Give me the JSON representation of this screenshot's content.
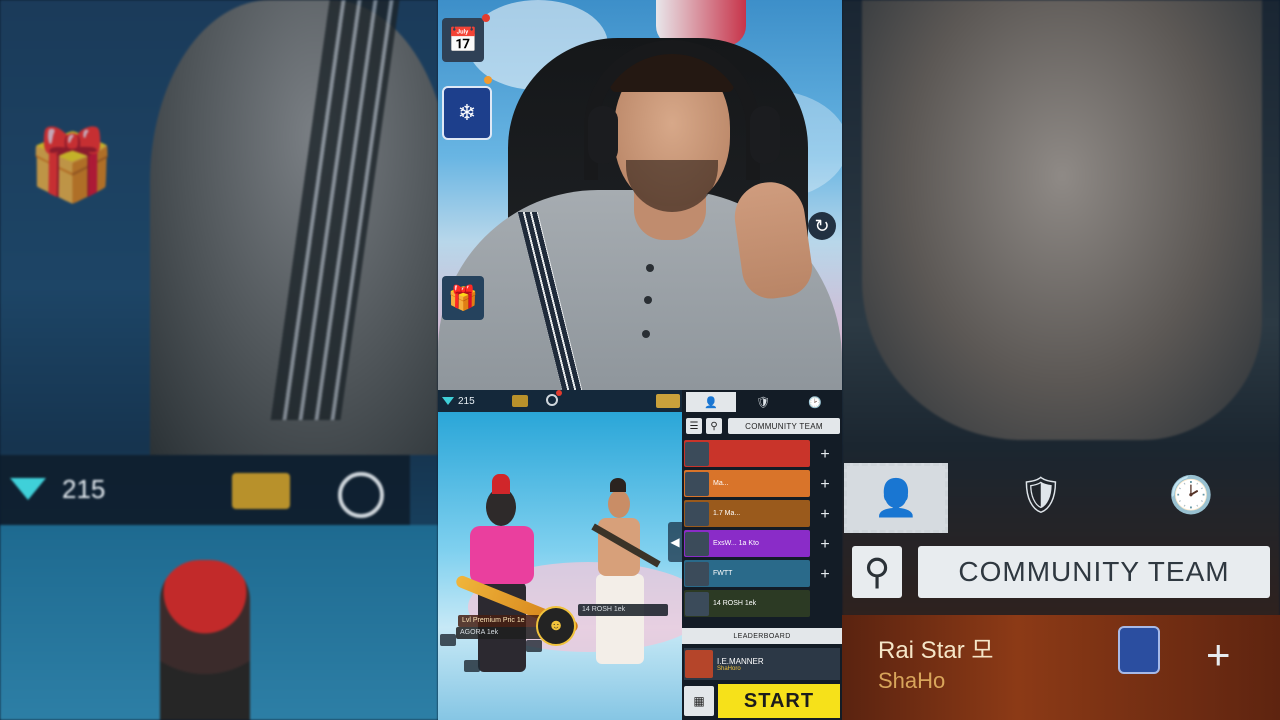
{
  "left_mirror": {
    "diamond_count": "215",
    "gift_icon": "gift-icon",
    "gold_icon": "gold-icon",
    "ring_icon": "ring-icon"
  },
  "right_mirror": {
    "tabs": [
      "profile-tab-icon",
      "guild-tab-icon",
      "history-tab-icon"
    ],
    "community_label": "COMMUNITY TEAM",
    "row": {
      "name": "Rai  Star  모",
      "sub": "ShaHo"
    }
  },
  "webcam": {
    "overlay_icons": [
      "calendar-icon",
      "event-badge-icon",
      "gift-icon",
      "refresh-icon"
    ]
  },
  "lobby": {
    "diamond_count": "215",
    "scene_tags": {
      "tag1": "Lvl Premium  Pric 1e",
      "tag2": "AGORA  1ek",
      "tag3": "14   ROSH  1ek"
    },
    "panel": {
      "community_label": "COMMUNITY TEAM",
      "friends": [
        {
          "name": "",
          "color": "#c9342a"
        },
        {
          "name": "Ma...",
          "color": "#d9742a"
        },
        {
          "name": "1.7  Ma...",
          "color": "#9a5a1c"
        },
        {
          "name": "ExsW... 1a  Kto",
          "color": "#8a2cc8"
        },
        {
          "name": "FWTT",
          "color": "#2a6a8a"
        },
        {
          "name": "14   ROSH   1ek",
          "color": "#2c3a24"
        }
      ],
      "leaderboard_label": "LEADERBOARD",
      "self_name": "I.E.MANNER",
      "self_sub": "ShaHoro",
      "start_label": "START"
    }
  },
  "colors": {
    "start_yellow": "#f6e11a",
    "diamond_cyan": "#3fd0d9",
    "panel_bg": "#131c26"
  }
}
